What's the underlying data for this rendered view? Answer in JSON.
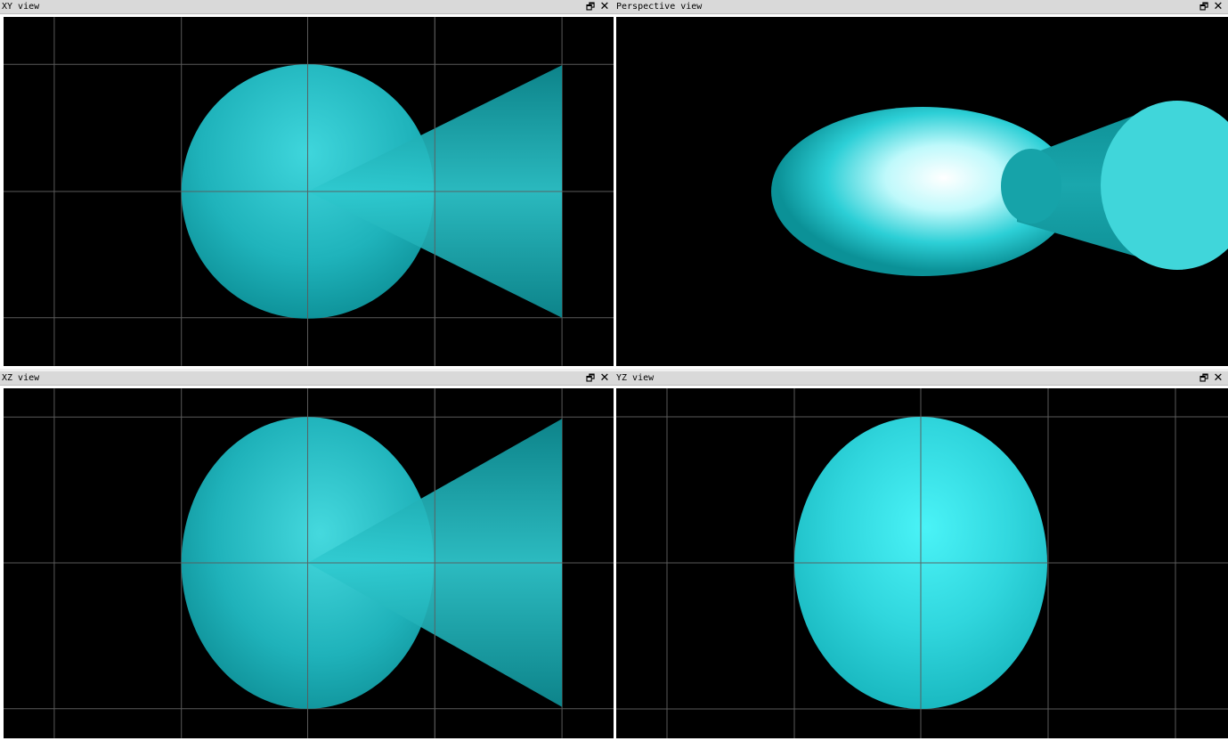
{
  "viewports": {
    "xy": {
      "title": "XY view",
      "restore_icon": "restore-icon",
      "close_icon": "close-icon"
    },
    "perspective": {
      "title": "Perspective view",
      "restore_icon": "restore-icon",
      "close_icon": "close-icon"
    },
    "xz": {
      "title": "XZ view",
      "restore_icon": "restore-icon",
      "close_icon": "close-icon"
    },
    "yz": {
      "title": "YZ view",
      "restore_icon": "restore-icon",
      "close_icon": "close-icon"
    }
  },
  "glyphs": {
    "restore": "🗗",
    "close": "✕"
  },
  "colors": {
    "viewport_bg": "#000000",
    "grid": "#5a5a5a",
    "object": "#26c5cc",
    "object_dark": "#0a8f95",
    "object_light": "#48eaf0",
    "highlight": "#ffffff",
    "titlebar": "#d9d9d9"
  }
}
